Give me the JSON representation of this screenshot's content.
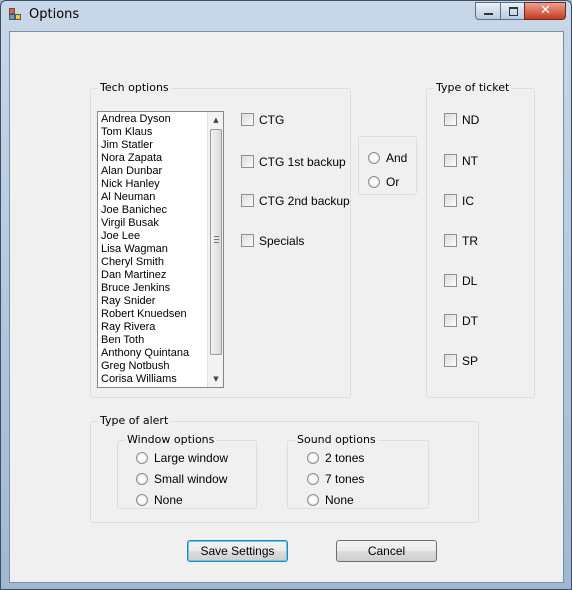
{
  "window": {
    "title": "Options"
  },
  "tech_options": {
    "legend": "Tech options",
    "techs": [
      "Andrea Dyson",
      "Tom Klaus",
      "Jim Statler",
      "Nora Zapata",
      "Alan Dunbar",
      "Nick Hanley",
      "Al Neuman",
      "Joe Banichec",
      "Virgil Busak",
      "Joe Lee",
      "Lisa Wagman",
      "Cheryl Smith",
      "Dan Martinez",
      "Bruce Jenkins",
      "Ray Snider",
      "Robert Knuedsen",
      "Ray Rivera",
      "Ben Toth",
      "Anthony Quintana",
      "Greg Notbush",
      "Corisa Williams"
    ],
    "checkboxes": [
      "CTG",
      "CTG 1st backup",
      "CTG 2nd backup",
      "Specials"
    ]
  },
  "logic": {
    "and": "And",
    "or": "Or"
  },
  "ticket_type": {
    "legend": "Type of ticket",
    "options": [
      "ND",
      "NT",
      "IC",
      "TR",
      "DL",
      "DT",
      "SP"
    ]
  },
  "alert": {
    "legend": "Type of alert",
    "window_legend": "Window options",
    "window_options": [
      "Large window",
      "Small window",
      "None"
    ],
    "sound_legend": "Sound options",
    "sound_options": [
      "2 tones",
      "7 tones",
      "None"
    ]
  },
  "buttons": {
    "save": "Save Settings",
    "cancel": "Cancel"
  }
}
